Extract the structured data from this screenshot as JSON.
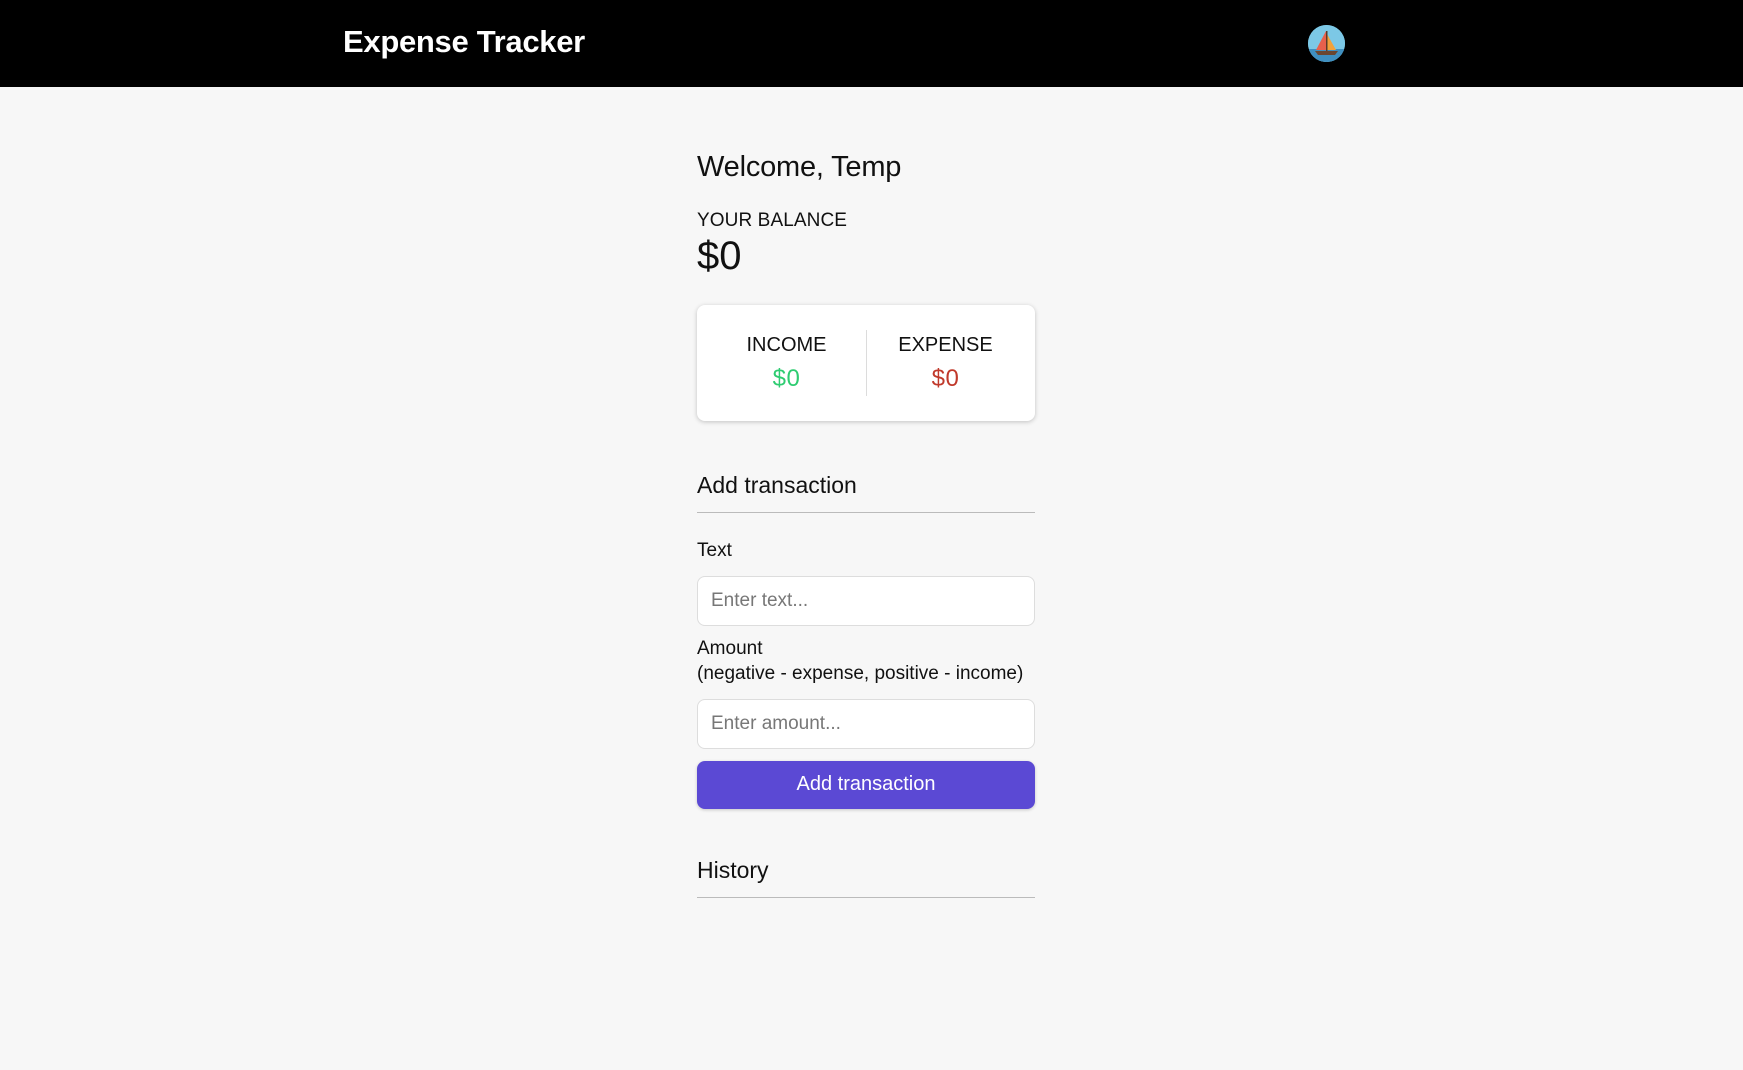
{
  "app": {
    "title": "Expense Tracker",
    "avatar_icon": "sailboat-avatar-icon"
  },
  "welcome": "Welcome, Temp",
  "balance": {
    "label": "YOUR BALANCE",
    "value": "$0"
  },
  "summary": {
    "income_label": "INCOME",
    "income_value": "$0",
    "expense_label": "EXPENSE",
    "expense_value": "$0",
    "income_color": "#2ecc71",
    "expense_color": "#c0392b"
  },
  "add_transaction": {
    "title": "Add transaction",
    "text_label": "Text",
    "text_placeholder": "Enter text...",
    "text_value": "",
    "amount_label_line1": "Amount",
    "amount_label_line2": "(negative - expense, positive - income)",
    "amount_placeholder": "Enter amount...",
    "amount_value": "",
    "button_label": "Add transaction",
    "button_color": "#5b49d4"
  },
  "history": {
    "title": "History",
    "items": []
  }
}
